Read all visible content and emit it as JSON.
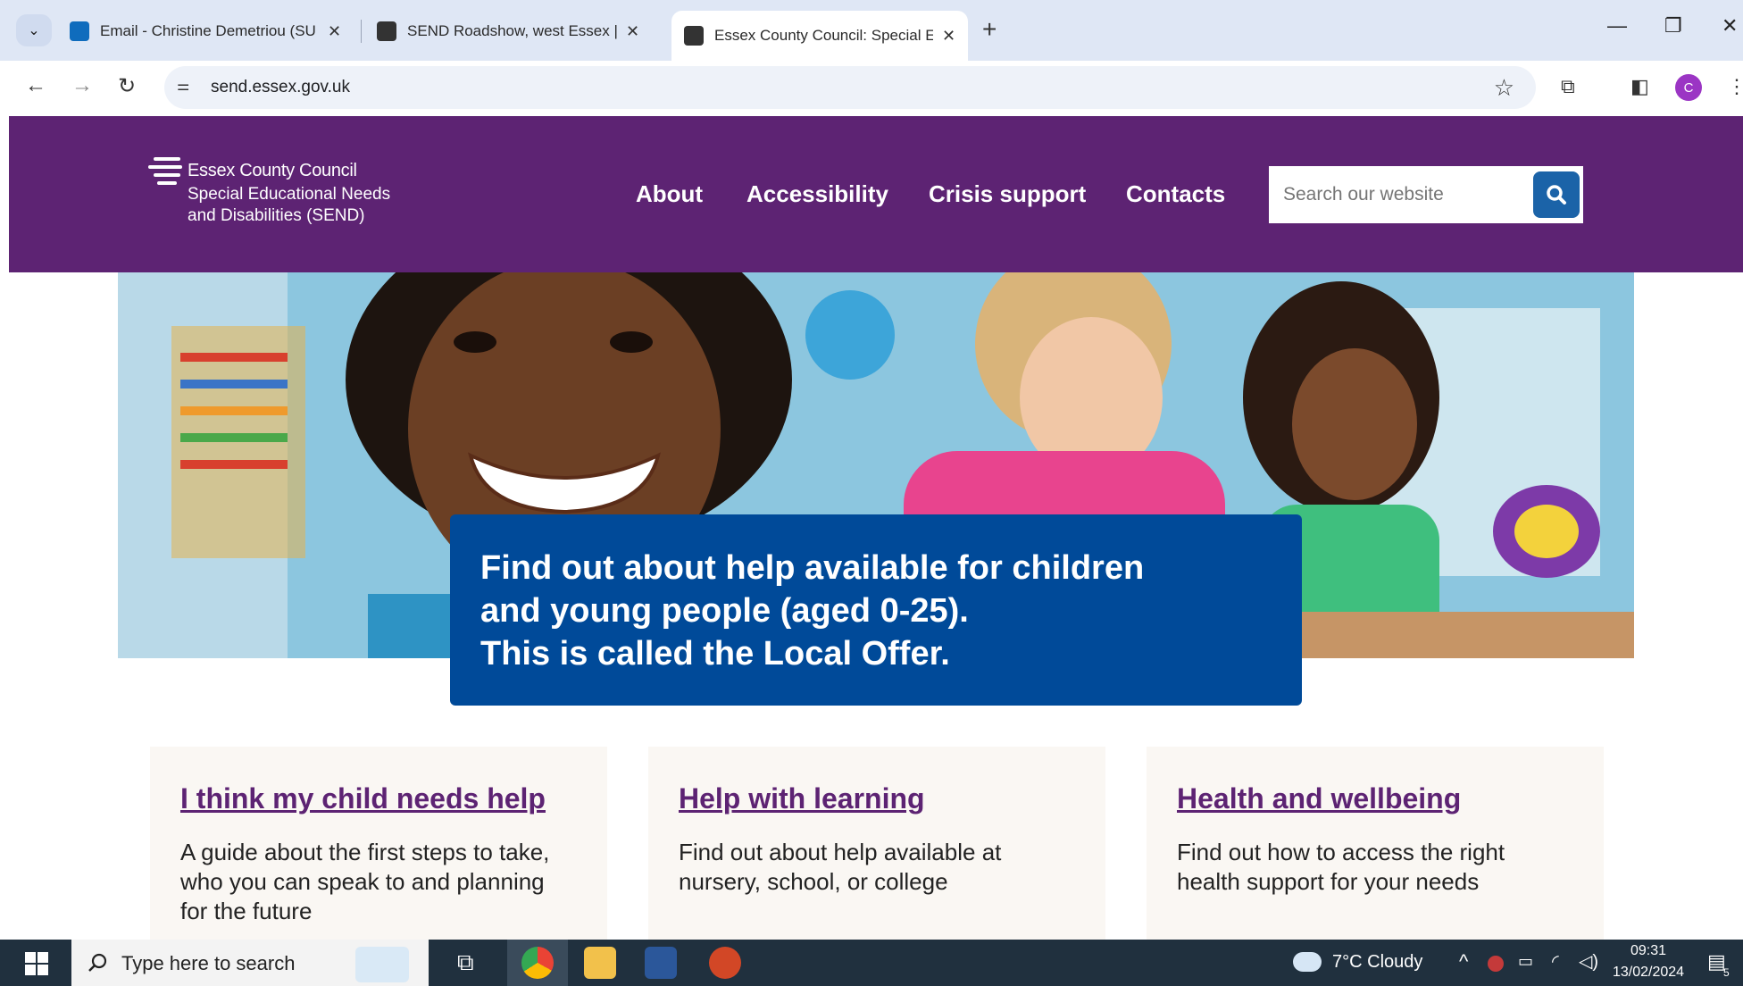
{
  "browser": {
    "tabs": [
      {
        "title": "Email - Christine Demetriou (SU",
        "close": "✕"
      },
      {
        "title": "SEND Roadshow, west Essex | E",
        "close": "✕"
      },
      {
        "title": "Essex County Council: Special E",
        "close": "✕"
      }
    ],
    "new_tab": "+",
    "url": "send.essex.gov.uk",
    "profile_initial": "C"
  },
  "site": {
    "org_name": "Essex County Council",
    "service_name_line1": "Special Educational Needs",
    "service_name_line2": "and Disabilities (SEND)",
    "nav": [
      "About",
      "Accessibility",
      "Crisis support",
      "Contacts"
    ],
    "search_placeholder": "Search our website"
  },
  "hero": {
    "line1": "Find out about help available for children",
    "line2": "and young people (aged 0-25).",
    "line3": "This is called the Local Offer."
  },
  "cards": [
    {
      "title": "I think my child needs help",
      "text": "A guide about the first steps to take, who you can speak to and planning for the future"
    },
    {
      "title": "Help with learning",
      "text": "Find out about help available at nursery, school, or college"
    },
    {
      "title": "Health and wellbeing",
      "text": "Find out how to access the right health support for your needs"
    }
  ],
  "taskbar": {
    "search_placeholder": "Type here to search",
    "weather": "7°C  Cloudy",
    "time": "09:31",
    "date": "13/02/2024",
    "notification_count": "5"
  }
}
